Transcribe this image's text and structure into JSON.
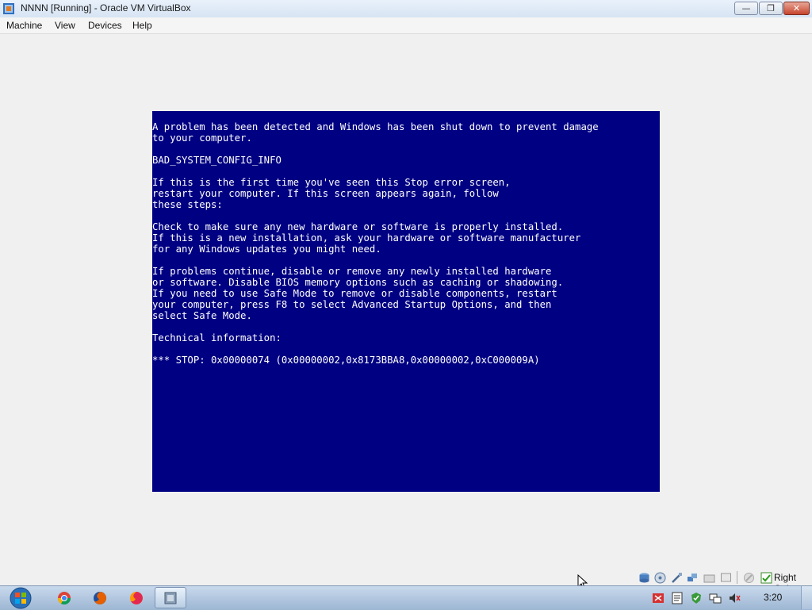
{
  "window": {
    "title": "NNNN [Running] - Oracle VM VirtualBox",
    "minimize_label": "—",
    "maximize_label": "❐",
    "close_label": "✕"
  },
  "menu": {
    "items": [
      "Machine",
      "View",
      "Devices",
      "Help"
    ]
  },
  "bsod": {
    "lines": [
      "A problem has been detected and Windows has been shut down to prevent damage",
      "to your computer.",
      "",
      "BAD_SYSTEM_CONFIG_INFO",
      "",
      "If this is the first time you've seen this Stop error screen,",
      "restart your computer. If this screen appears again, follow",
      "these steps:",
      "",
      "Check to make sure any new hardware or software is properly installed.",
      "If this is a new installation, ask your hardware or software manufacturer",
      "for any Windows updates you might need.",
      "",
      "If problems continue, disable or remove any newly installed hardware",
      "or software. Disable BIOS memory options such as caching or shadowing.",
      "If you need to use Safe Mode to remove or disable components, restart",
      "your computer, press F8 to select Advanced Startup Options, and then",
      "select Safe Mode.",
      "",
      "Technical information:",
      "",
      "*** STOP: 0x00000074 (0x00000002,0x8173BBA8,0x00000002,0xC000009A)"
    ]
  },
  "vbox_status": {
    "host_key_label": "Right Ctrl",
    "icons": [
      "hard-disk-icon",
      "optical-drive-icon",
      "usb-icon",
      "network-icon",
      "shared-folders-icon",
      "display-icon",
      "recording-icon",
      "mouse-integration-icon"
    ]
  },
  "taskbar": {
    "pinned": [
      "chrome-icon",
      "firefox-icon",
      "firefox-alt-icon",
      "virtualbox-icon"
    ],
    "tray_icons": [
      "flag-icon",
      "notes-icon",
      "security-shield-icon",
      "network-tray-icon",
      "volume-mute-icon"
    ],
    "clock": "3:20"
  },
  "colors": {
    "bsod_background": "#000082",
    "bsod_text": "#ffffff"
  }
}
